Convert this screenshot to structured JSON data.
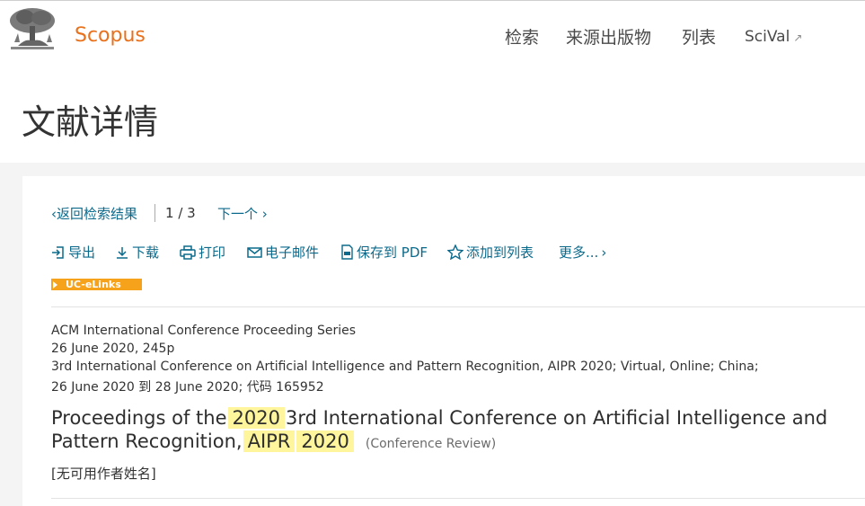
{
  "header": {
    "brand": "Scopus",
    "nav": [
      {
        "label": "检索"
      },
      {
        "label": "来源出版物"
      },
      {
        "label": "列表"
      },
      {
        "label": "SciVal",
        "external": true
      }
    ],
    "external_arrow": "↗"
  },
  "page": {
    "title": "文献详情"
  },
  "navigation": {
    "back_label": "返回检索结果",
    "current": "1",
    "slash": "/",
    "total": "3",
    "next_label": "下一个"
  },
  "toolbar": [
    {
      "label": "导出",
      "icon": "export-icon"
    },
    {
      "label": "下载",
      "icon": "download-icon"
    },
    {
      "label": "打印",
      "icon": "print-icon"
    },
    {
      "label": "电子邮件",
      "icon": "email-icon"
    },
    {
      "label": "保存到 PDF",
      "icon": "pdf-icon"
    },
    {
      "label": "添加到列表",
      "icon": "star-icon"
    },
    {
      "label": "更多...",
      "icon": "chevron-right-icon"
    }
  ],
  "badge": {
    "label": "UC-eLinks"
  },
  "document": {
    "series": "ACM International Conference Proceeding Series",
    "date_pages": "26 June 2020, 245p",
    "conference": "3rd International Conference on Artificial Intelligence and Pattern Recognition, AIPR 2020; Virtual, Online; China;",
    "conference_dates": "26 June 2020 到 28 June 2020; 代码 165952",
    "title_parts": [
      "Proceedings of the",
      "2020",
      "3rd International Conference on Artificial Intelligence and Pattern Recognition,",
      "AIPR",
      "2020"
    ],
    "type": "(Conference Review)",
    "authors": "[无可用作者姓名]"
  },
  "colors": {
    "brand": "#e9711c",
    "link": "#0b6a8c",
    "badge": "#f7a21b",
    "highlight": "#fff59d"
  }
}
